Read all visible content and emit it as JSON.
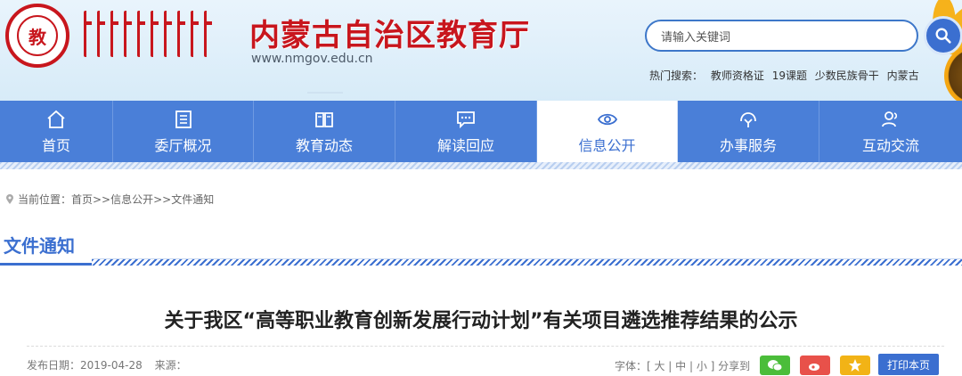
{
  "header": {
    "site_title": "内蒙古自治区教育厅",
    "site_url": "www.nmgov.edu.cn",
    "emblem_text": "教"
  },
  "search": {
    "placeholder": "请输入关键词",
    "hot_label": "热门搜索：",
    "hot_terms": [
      "教师资格证",
      "19课题",
      "少数民族骨干",
      "内蒙古"
    ]
  },
  "nav": {
    "items": [
      {
        "label": "首页",
        "icon": "home-icon"
      },
      {
        "label": "委厅概况",
        "icon": "list-icon"
      },
      {
        "label": "教育动态",
        "icon": "book-icon"
      },
      {
        "label": "解读回应",
        "icon": "chat-icon"
      },
      {
        "label": "信息公开",
        "icon": "eye-icon",
        "active": true
      },
      {
        "label": "办事服务",
        "icon": "service-icon"
      },
      {
        "label": "互动交流",
        "icon": "users-icon"
      }
    ]
  },
  "breadcrumb": "当前位置：首页>>信息公开>>文件通知",
  "section_title": "文件通知",
  "article": {
    "title": "关于我区“高等职业教育创新发展行动计划”有关项目遴选推荐结果的公示",
    "publish_label": "发布日期：2019-04-28",
    "source_label": "来源：",
    "font_label": "字体：[ 大 | 中 | 小 ] 分享到",
    "print_label": "打印本页"
  },
  "colors": {
    "brand_red": "#c8161d",
    "nav_blue": "#4a7fd8",
    "accent_blue": "#3b6fd0"
  }
}
